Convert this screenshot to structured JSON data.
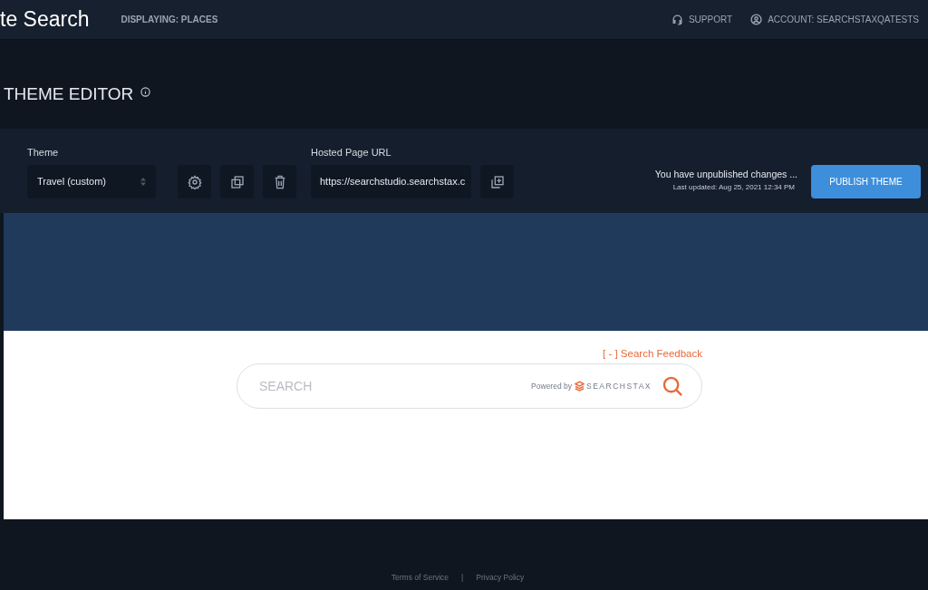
{
  "header": {
    "app_title": "te Search",
    "displaying": "DISPLAYING: PLACES",
    "support": "SUPPORT",
    "account": "ACCOUNT: SEARCHSTAXQATESTS"
  },
  "page_title": "THEME EDITOR",
  "toolbar": {
    "theme_label": "Theme",
    "theme_value": "Travel (custom)",
    "url_label": "Hosted Page URL",
    "url_value": "https://searchstudio.searchstax.c",
    "status": "You have unpublished changes ...",
    "last_updated": "Last updated: Aug 25, 2021 12:34 PM",
    "publish": "PUBLISH THEME"
  },
  "preview": {
    "feedback": "[ - ] Search Feedback",
    "placeholder": "SEARCH",
    "powered_by": "Powered by",
    "brand": "SEARCHSTAX"
  },
  "footer": {
    "links": [
      "Terms of Service",
      "Privacy Policy"
    ],
    "separator": "|"
  }
}
